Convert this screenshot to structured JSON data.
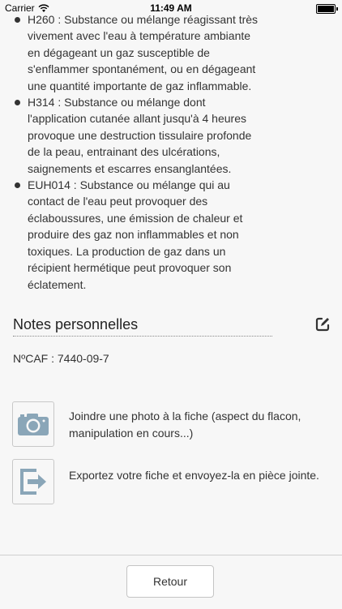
{
  "status_bar": {
    "carrier": "Carrier",
    "time": "11:49 AM"
  },
  "hazards": [
    {
      "text": "H260 : Substance ou mélange réagissant très vivement avec l'eau à température ambiante en dégageant un gaz susceptible de s'enflammer spontanément, ou en dégageant une quantité importante de gaz inflammable."
    },
    {
      "text": "H314 : Substance ou mélange dont l'application cutanée allant jusqu'à 4 heures provoque une destruction tissulaire profonde de la peau, entrainant des ulcérations, saignements et escarres ensanglantées."
    },
    {
      "text": "EUH014 : Substance ou mélange qui au contact de l'eau peut provoquer des éclaboussures, une émission de chaleur et produire des gaz non inflammables et non toxiques. La production de gaz dans un récipient hermétique peut provoquer son éclatement."
    }
  ],
  "notes": {
    "title": "Notes personnelles",
    "edit_icon": "edit-icon"
  },
  "caf": "NºCAF : 7440-09-7",
  "actions": {
    "photo": {
      "label": "Joindre une photo à la fiche (aspect du flacon, manipulation en cours...)",
      "icon": "camera-icon"
    },
    "export": {
      "label": "Exportez votre fiche et envoyez-la en pièce jointe.",
      "icon": "export-icon"
    }
  },
  "footer": {
    "back_label": "Retour"
  },
  "colors": {
    "icon": "#8aa6b8",
    "background": "#f7f7f7"
  }
}
